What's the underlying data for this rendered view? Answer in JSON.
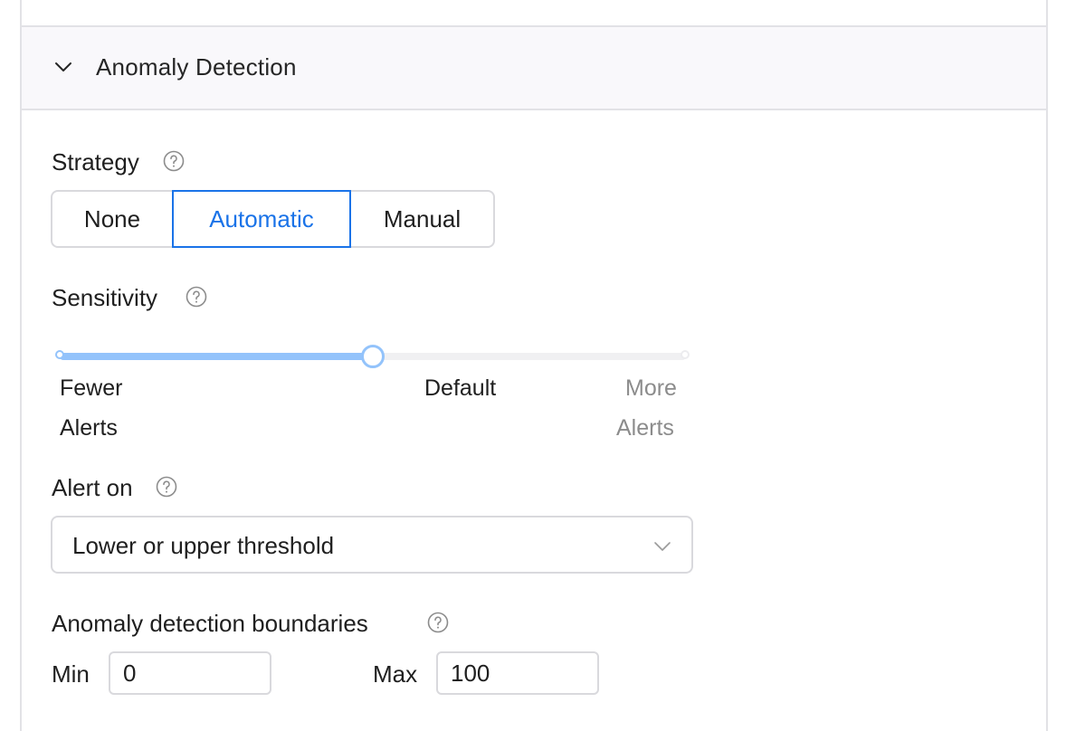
{
  "section": {
    "title": "Anomaly Detection",
    "chevron_icon": "chevron-down-icon"
  },
  "strategy": {
    "label": "Strategy",
    "help_icon": "question-circle-icon",
    "options": [
      "None",
      "Automatic",
      "Manual"
    ],
    "selected": "Automatic"
  },
  "sensitivity": {
    "label": "Sensitivity",
    "help_icon": "question-circle-icon",
    "level": 0.5,
    "marks": {
      "fewer_line1": "Fewer",
      "fewer_line2": "Alerts",
      "default": "Default",
      "more_line1": "More",
      "more_line2": "Alerts"
    }
  },
  "alert_on": {
    "label": "Alert on",
    "help_icon": "question-circle-icon",
    "value": "Lower or upper threshold",
    "arrow_icon": "chevron-down-icon"
  },
  "boundaries": {
    "label": "Anomaly detection boundaries",
    "help_icon": "question-circle-icon",
    "min_label": "Min",
    "min_value": "0",
    "max_label": "Max",
    "max_value": "100"
  },
  "colors": {
    "accent": "#1a73e8",
    "slider_fill": "#93c3fb",
    "border": "#d9d9dd",
    "header_bg": "#f9f8fb",
    "muted_text": "#8c8c8c"
  }
}
